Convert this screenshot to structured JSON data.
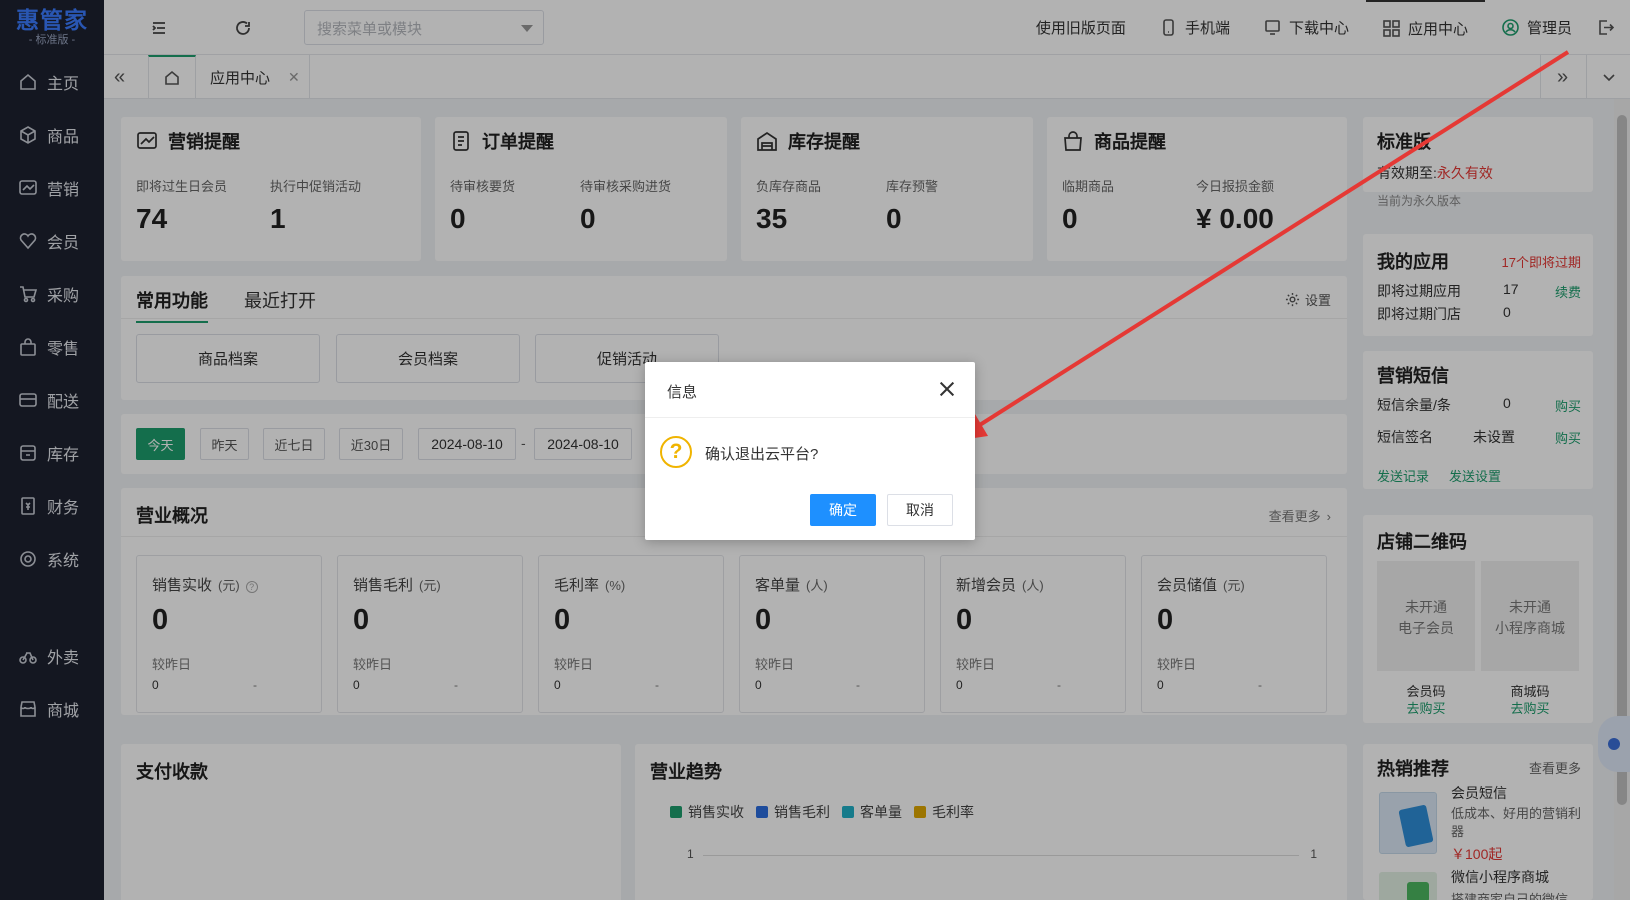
{
  "logo": {
    "main": "惠管家",
    "sub": "- 标准版 -"
  },
  "sidebar": {
    "items": [
      {
        "label": "主页",
        "icon": "home-icon"
      },
      {
        "label": "商品",
        "icon": "box-icon"
      },
      {
        "label": "营销",
        "icon": "chart-icon"
      },
      {
        "label": "会员",
        "icon": "heart-icon"
      },
      {
        "label": "采购",
        "icon": "cart-icon"
      },
      {
        "label": "零售",
        "icon": "bag-icon"
      },
      {
        "label": "配送",
        "icon": "truck-icon"
      },
      {
        "label": "库存",
        "icon": "warehouse-icon"
      },
      {
        "label": "财务",
        "icon": "finance-icon"
      },
      {
        "label": "系统",
        "icon": "settings-icon"
      },
      {
        "label": "外卖",
        "icon": "bike-icon"
      },
      {
        "label": "商城",
        "icon": "store-icon"
      }
    ]
  },
  "topbar": {
    "search_placeholder": "搜索菜单或模块",
    "links": {
      "old_page": "使用旧版页面",
      "mobile": "手机端",
      "download": "下载中心",
      "app_center": "应用中心",
      "admin": "管理员"
    }
  },
  "tabs": {
    "active": "应用中心"
  },
  "reminders": {
    "marketing": {
      "title": "营销提醒",
      "l1": "即将过生日会员",
      "v1": "74",
      "l2": "执行中促销活动",
      "v2": "1"
    },
    "order": {
      "title": "订单提醒",
      "l1": "待审核要货",
      "v1": "0",
      "l2": "待审核采购进货",
      "v2": "0"
    },
    "stock": {
      "title": "库存提醒",
      "l1": "负库存商品",
      "v1": "35",
      "l2": "库存预警",
      "v2": "0"
    },
    "goods": {
      "title": "商品提醒",
      "l1": "临期商品",
      "v1": "0",
      "l2": "今日报损金额",
      "v2": "¥ 0.00"
    }
  },
  "functions": {
    "tab1": "常用功能",
    "tab2": "最近打开",
    "settings": "设置",
    "buttons": [
      "商品档案",
      "会员档案",
      "促销活动"
    ]
  },
  "dates": {
    "today": "今天",
    "yesterday": "昨天",
    "week": "近七日",
    "month": "近30日",
    "start": "2024-08-10",
    "sep": "-",
    "end": "2024-08-10"
  },
  "overview": {
    "title": "营业概况",
    "more": "查看更多",
    "compare": "较昨日",
    "stats": [
      {
        "label": "销售实收",
        "unit": "(元)",
        "value": "0",
        "prev": "0",
        "diff": "-"
      },
      {
        "label": "销售毛利",
        "unit": "(元)",
        "value": "0",
        "prev": "0",
        "diff": "-"
      },
      {
        "label": "毛利率",
        "unit": "(%)",
        "value": "0",
        "prev": "0",
        "diff": "-"
      },
      {
        "label": "客单量",
        "unit": "(人)",
        "value": "0",
        "prev": "0",
        "diff": "-"
      },
      {
        "label": "新增会员",
        "unit": "(人)",
        "value": "0",
        "prev": "0",
        "diff": "-"
      },
      {
        "label": "会员储值",
        "unit": "(元)",
        "value": "0",
        "prev": "0",
        "diff": "-"
      }
    ]
  },
  "payment": {
    "title": "支付收款"
  },
  "trend": {
    "title": "营业趋势",
    "legend": [
      {
        "name": "销售实收",
        "color": "#1e9e6e"
      },
      {
        "name": "销售毛利",
        "color": "#2b6de0"
      },
      {
        "name": "客单量",
        "color": "#20b0c8"
      },
      {
        "name": "毛利率",
        "color": "#e0a800"
      }
    ],
    "y_left": "1",
    "y_right": "1"
  },
  "right": {
    "edition": {
      "title": "标准版",
      "valid_label": "有效期至:",
      "valid_value": "永久有效",
      "note": "当前为永久版本"
    },
    "apps": {
      "title": "我的应用",
      "badge": "17个即将过期",
      "r1": "即将过期应用",
      "v1": "17",
      "a1": "续费",
      "r2": "即将过期门店",
      "v2": "0"
    },
    "sms": {
      "title": "营销短信",
      "r1": "短信余量/条",
      "v1": "0",
      "a1": "购买",
      "r2": "短信签名",
      "v2": "未设置",
      "a2": "购买",
      "link1": "发送记录",
      "link2": "发送设置"
    },
    "qr": {
      "title": "店铺二维码",
      "box1": "未开通\n电子会员",
      "box2": "未开通\n小程序商城",
      "cap1": "会员码",
      "buy1": "去购买",
      "cap2": "商城码",
      "buy2": "去购买"
    },
    "hot": {
      "title": "热销推荐",
      "more": "查看更多",
      "p1": "会员短信",
      "d1": "低成本、好用的营销利器",
      "price1": "￥100起",
      "p2": "微信小程序商城",
      "d2": "搭建商家自己的微信"
    }
  },
  "dialog": {
    "title": "信息",
    "message": "确认退出云平台?",
    "ok": "确定",
    "cancel": "取消"
  }
}
